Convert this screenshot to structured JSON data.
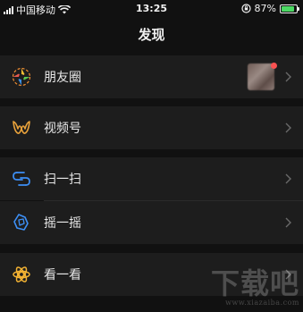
{
  "status_bar": {
    "carrier": "中国移动",
    "time": "13:25",
    "battery_percent": "87%",
    "battery_level": 0.87,
    "icons": [
      "signal-icon",
      "wifi-icon",
      "orientation-lock-icon",
      "battery-icon"
    ]
  },
  "nav": {
    "title": "发现"
  },
  "menu": [
    {
      "label": "朋友圈",
      "icon": "moments-icon",
      "has_thumbnail": true,
      "has_badge": true
    },
    {
      "label": "视频号",
      "icon": "channels-icon"
    },
    {
      "label": "扫一扫",
      "icon": "scan-icon"
    },
    {
      "label": "摇一摇",
      "icon": "shake-icon"
    },
    {
      "label": "看一看",
      "icon": "top-stories-icon"
    }
  ],
  "colors": {
    "background": "#111111",
    "row": "#1d1d1d",
    "badge": "#fa5151",
    "battery": "#4cd964",
    "scan_icon": "#3d8ff5",
    "channels_icon": "#e9a23b",
    "top_stories_icon": "#f2b233"
  },
  "watermark": {
    "main": "下载吧",
    "sub": "www.xiazaiba.com"
  }
}
